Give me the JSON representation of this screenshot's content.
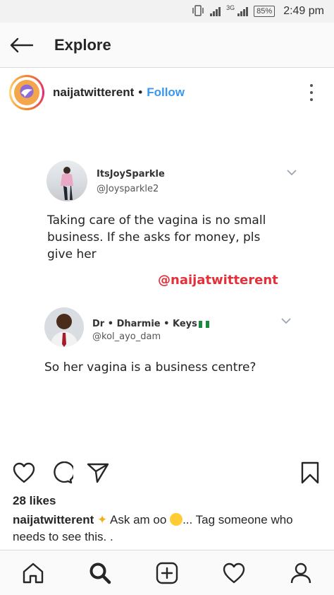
{
  "status_bar": {
    "network": "3G",
    "battery": "85%",
    "time": "2:49 pm"
  },
  "header": {
    "title": "Explore"
  },
  "post": {
    "username": "naijatwitterent",
    "separator": "•",
    "follow_label": "Follow",
    "image": {
      "tweet_1": {
        "name": "ItsJoySparkle",
        "handle": "@Joysparkle2",
        "text": "Taking care of the vagina is no small business. If she asks for money, pls give her"
      },
      "watermark": "@naijatwitterent",
      "tweet_2": {
        "name": "Dr • Dharmie • Keys",
        "handle": "@kol_ayo_dam",
        "text": "So her vagina is a business centre?"
      }
    },
    "likes": "28 likes",
    "caption": {
      "username": "naijatwitterent",
      "text_a": " Ask am oo ",
      "text_b": "... Tag someone who needs to see this. ."
    }
  },
  "colors": {
    "follow": "#3897f0",
    "watermark": "#e4303a"
  },
  "icons": {
    "back": "arrow-left-icon",
    "more": "more-vertical-icon",
    "like": "heart-icon",
    "comment": "comment-icon",
    "share": "send-icon",
    "save": "bookmark-icon",
    "nav": [
      "home-icon",
      "search-icon",
      "add-icon",
      "activity-icon",
      "profile-icon"
    ]
  }
}
